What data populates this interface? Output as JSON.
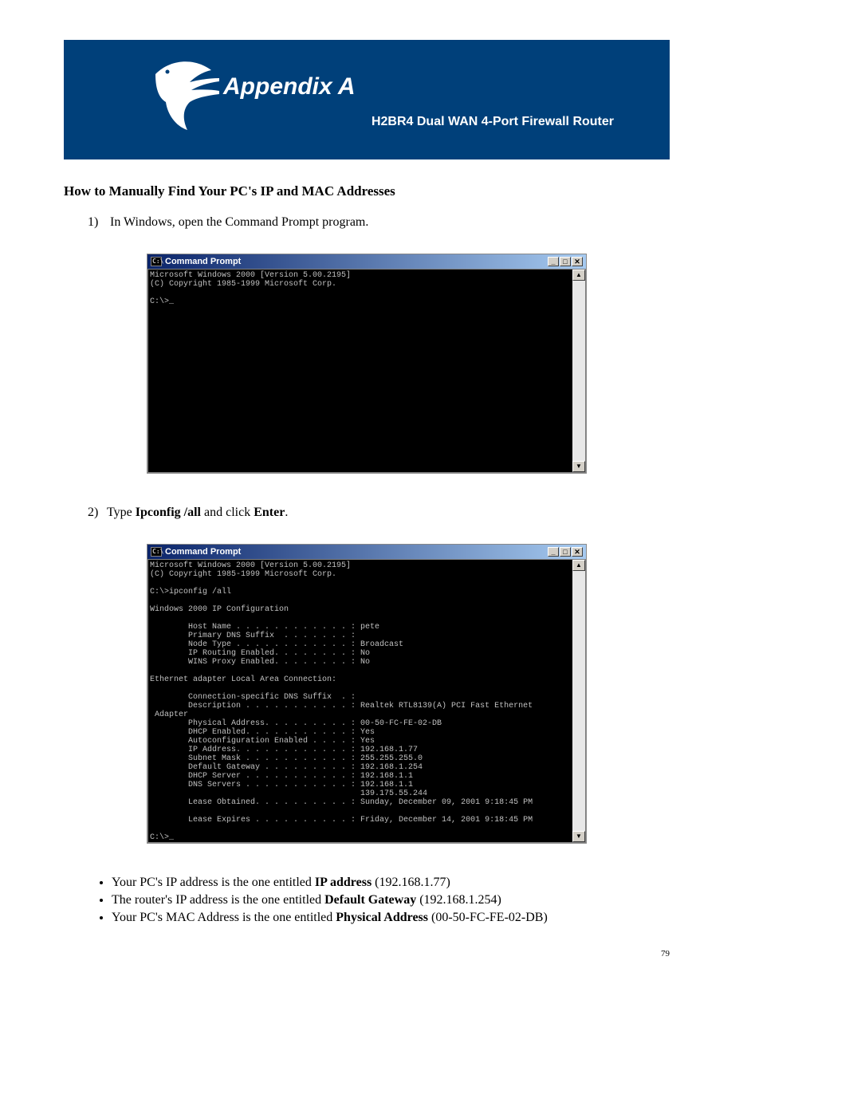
{
  "banner": {
    "title": "Appendix A",
    "subtitle": "H2BR4  Dual WAN 4-Port Firewall Router"
  },
  "section_heading": "How to Manually Find Your PC's IP and MAC Addresses",
  "step1": {
    "num": "1)",
    "text": "In Windows, open the Command Prompt program."
  },
  "cmd1": {
    "title": "Command Prompt",
    "icon_text": "C:\\",
    "body": "Microsoft Windows 2000 [Version 5.00.2195]\n(C) Copyright 1985-1999 Microsoft Corp.\n\nC:\\>_"
  },
  "step2": {
    "num": "2)",
    "pre": "Type ",
    "bold1": "Ipconfig /all",
    "mid": " and click ",
    "bold2": "Enter",
    "post": "."
  },
  "cmd2": {
    "title": "Command Prompt",
    "icon_text": "C:\\",
    "body": "Microsoft Windows 2000 [Version 5.00.2195]\n(C) Copyright 1985-1999 Microsoft Corp.\n\nC:\\>ipconfig /all\n\nWindows 2000 IP Configuration\n\n        Host Name . . . . . . . . . . . . : pete\n        Primary DNS Suffix  . . . . . . . :\n        Node Type . . . . . . . . . . . . : Broadcast\n        IP Routing Enabled. . . . . . . . : No\n        WINS Proxy Enabled. . . . . . . . : No\n\nEthernet adapter Local Area Connection:\n\n        Connection-specific DNS Suffix  . :\n        Description . . . . . . . . . . . : Realtek RTL8139(A) PCI Fast Ethernet\n Adapter\n        Physical Address. . . . . . . . . : 00-50-FC-FE-02-DB\n        DHCP Enabled. . . . . . . . . . . : Yes\n        Autoconfiguration Enabled . . . . : Yes\n        IP Address. . . . . . . . . . . . : 192.168.1.77\n        Subnet Mask . . . . . . . . . . . : 255.255.255.0\n        Default Gateway . . . . . . . . . : 192.168.1.254\n        DHCP Server . . . . . . . . . . . : 192.168.1.1\n        DNS Servers . . . . . . . . . . . : 192.168.1.1\n                                            139.175.55.244\n        Lease Obtained. . . . . . . . . . : Sunday, December 09, 2001 9:18:45 PM\n\n        Lease Expires . . . . . . . . . . : Friday, December 14, 2001 9:18:45 PM\n\nC:\\>_"
  },
  "bullets": {
    "b1_pre": "Your PC's IP address is the one entitled ",
    "b1_bold": "IP address",
    "b1_post": " (192.168.1.77)",
    "b2_pre": "The router's IP address is the one entitled ",
    "b2_bold": "Default Gateway",
    "b2_post": " (192.168.1.254)",
    "b3_pre": "Your PC's MAC Address is the one entitled ",
    "b3_bold": "Physical Address",
    "b3_post": "  (00-50-FC-FE-02-DB)"
  },
  "page_number": "79",
  "winbtns": {
    "min": "_",
    "max": "□",
    "close": "✕",
    "up": "▲",
    "down": "▼"
  }
}
